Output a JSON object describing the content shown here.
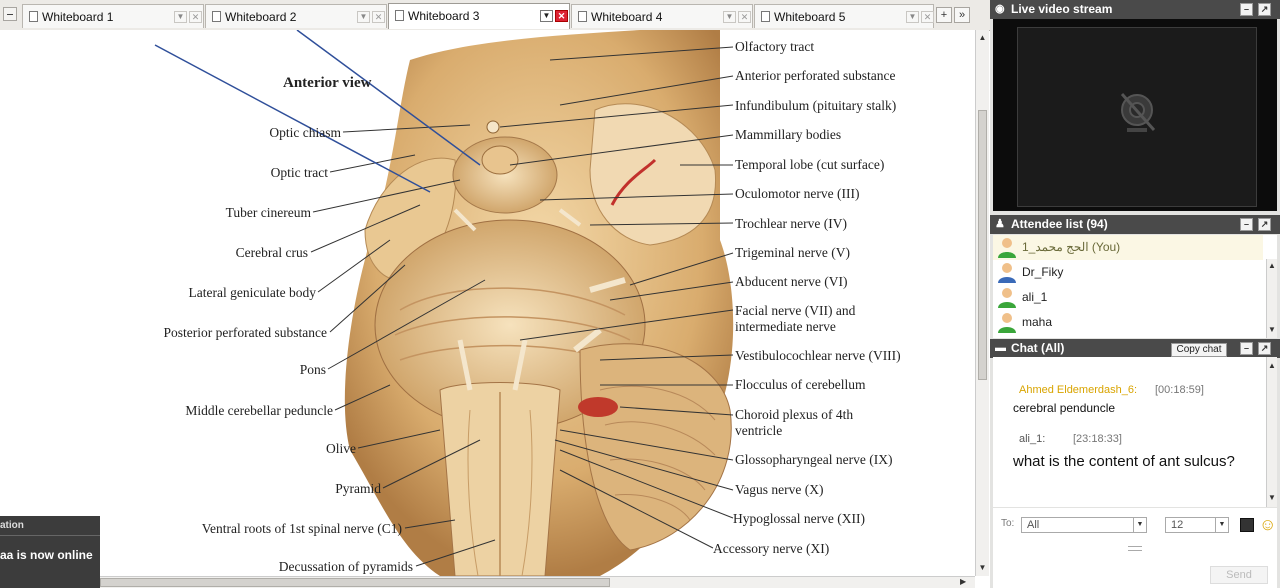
{
  "tabs": [
    {
      "label": "Whiteboard 1",
      "active": false
    },
    {
      "label": "Whiteboard 2",
      "active": false
    },
    {
      "label": "Whiteboard 3",
      "active": true
    },
    {
      "label": "Whiteboard 4",
      "active": false
    },
    {
      "label": "Whiteboard 5",
      "active": false
    }
  ],
  "tab_actions": {
    "add": "+",
    "more": "»"
  },
  "whiteboard": {
    "view_title": "Anterior view",
    "left_labels": [
      "Optic chiasm",
      "Optic tract",
      "Tuber cinereum",
      "Cerebral crus",
      "Lateral geniculate body",
      "Posterior perforated substance",
      "Pons",
      "Middle cerebellar peduncle",
      "Olive",
      "Pyramid",
      "Ventral roots of 1st spinal nerve (C1)",
      "Decussation of pyramids"
    ],
    "right_labels": [
      "Olfactory tract",
      "Anterior perforated substance",
      "Infundibulum (pituitary stalk)",
      "Mammillary bodies",
      "Temporal lobe (cut surface)",
      "Oculomotor nerve (III)",
      "Trochlear nerve (IV)",
      "Trigeminal nerve (V)",
      "Abducent nerve (VI)",
      "Facial nerve (VII) and",
      "intermediate nerve",
      "Vestibulocochlear nerve (VIII)",
      "Flocculus of cerebellum",
      "Choroid plexus of 4th",
      "ventricle",
      "Glossopharyngeal nerve (IX)",
      "Vagus nerve (X)",
      "Hypoglossal nerve (XII)",
      "Accessory nerve (XI)"
    ]
  },
  "notification": {
    "title": "ation",
    "message": "aa is now online"
  },
  "video_panel": {
    "title": "Live video stream",
    "icon": "webcam-icon"
  },
  "attendee_panel": {
    "title": "Attendee list (94)",
    "attendees": [
      {
        "name": "1_الحج محمد (You)",
        "is_self": true,
        "avatar": "user-green-icon"
      },
      {
        "name": "Dr_Fiky",
        "is_self": false,
        "avatar": "user-blue-icon"
      },
      {
        "name": "ali_1",
        "is_self": false,
        "avatar": "user-green-icon"
      },
      {
        "name": "maha",
        "is_self": false,
        "avatar": "user-green-icon"
      }
    ]
  },
  "chat_panel": {
    "title": "Chat (All)",
    "copy_button": "Copy chat",
    "messages": [
      {
        "sender": "Ahmed Eldemerdash_6:",
        "time": "[00:18:59]",
        "text": "cerebral penduncle",
        "sender_color": "#d9a400"
      },
      {
        "sender": "ali_1:",
        "time": "[23:18:33]",
        "text": "what is the content of ant sulcus?",
        "sender_color": "#555555"
      }
    ]
  },
  "compose": {
    "to_label": "To:",
    "to_value": "All",
    "font_size": "12",
    "send_label": "Send"
  },
  "colors": {
    "panel_header": "#4a4a4a",
    "annotation_line": "#2f4f9a",
    "sender_highlight": "#d9a400"
  }
}
